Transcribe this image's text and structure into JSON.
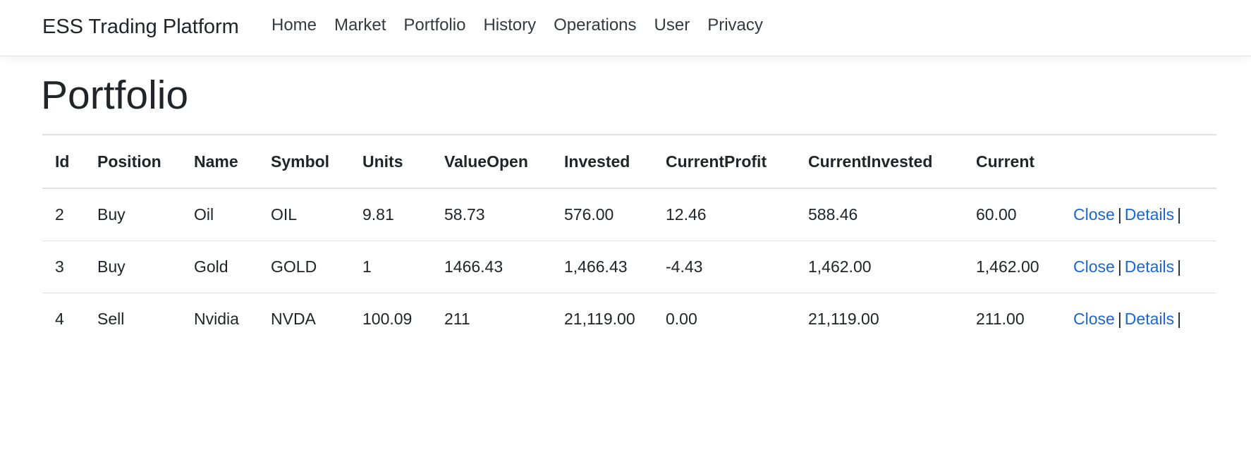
{
  "navbar": {
    "brand": "ESS Trading Platform",
    "links": [
      "Home",
      "Market",
      "Portfolio",
      "History",
      "Operations",
      "User",
      "Privacy"
    ]
  },
  "page": {
    "title": "Portfolio"
  },
  "table": {
    "headers": [
      "Id",
      "Position",
      "Name",
      "Symbol",
      "Units",
      "ValueOpen",
      "Invested",
      "CurrentProfit",
      "CurrentInvested",
      "Current",
      ""
    ],
    "rows": [
      {
        "id": "2",
        "position": "Buy",
        "name": "Oil",
        "symbol": "OIL",
        "units": "9.81",
        "value_open": "58.73",
        "invested": "576.00",
        "current_profit": "12.46",
        "current_invested": "588.46",
        "current": "60.00",
        "close_label": "Close",
        "separator": "|",
        "details_label": "Details",
        "trailing": "|"
      },
      {
        "id": "3",
        "position": "Buy",
        "name": "Gold",
        "symbol": "GOLD",
        "units": "1",
        "value_open": "1466.43",
        "invested": "1,466.43",
        "current_profit": "-4.43",
        "current_invested": "1,462.00",
        "current": "1,462.00",
        "close_label": "Close",
        "separator": "|",
        "details_label": "Details",
        "trailing": "|"
      },
      {
        "id": "4",
        "position": "Sell",
        "name": "Nvidia",
        "symbol": "NVDA",
        "units": "100.09",
        "value_open": "211",
        "invested": "21,119.00",
        "current_profit": "0.00",
        "current_invested": "21,119.00",
        "current": "211.00",
        "close_label": "Close",
        "separator": "|",
        "details_label": "Details",
        "trailing": "|"
      }
    ]
  },
  "colors": {
    "link": "#1a67d2",
    "text": "#212529",
    "border": "#dee2e6"
  }
}
